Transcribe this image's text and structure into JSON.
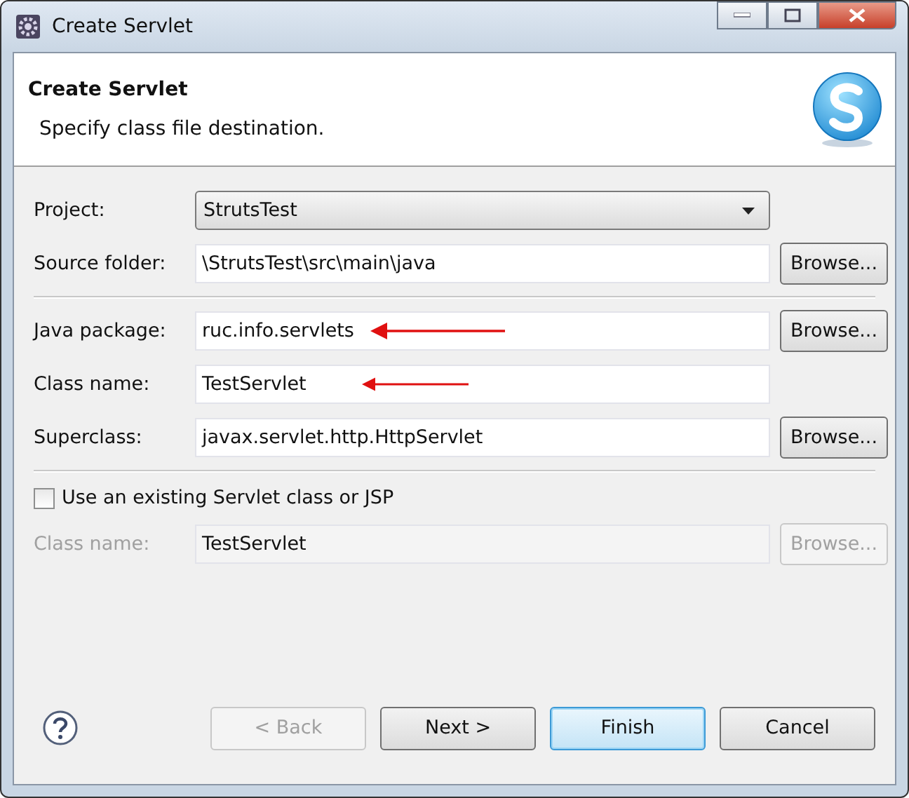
{
  "window": {
    "title": "Create Servlet"
  },
  "header": {
    "title": "Create Servlet",
    "description": "Specify class file destination."
  },
  "groups": [
    {
      "rows": [
        {
          "kind": "select",
          "label": "Project:",
          "value": "StrutsTest",
          "arrow": false
        },
        {
          "kind": "text",
          "label": "Source folder:",
          "value": "\\StrutsTest\\src\\main\\java",
          "browse": "Browse...",
          "arrow": false
        }
      ]
    },
    {
      "rows": [
        {
          "kind": "text",
          "label": "Java package:",
          "value": "ruc.info.servlets",
          "browse": "Browse...",
          "arrow": true
        },
        {
          "kind": "text",
          "label": "Class name:",
          "value": "TestServlet",
          "arrow": true
        },
        {
          "kind": "text",
          "label": "Superclass:",
          "value": "javax.servlet.http.HttpServlet",
          "browse": "Browse...",
          "arrow": false
        }
      ]
    }
  ],
  "existing": {
    "label": "Use an existing Servlet class or JSP",
    "checked": false,
    "row": {
      "label": "Class name:",
      "value": "TestServlet",
      "browse": "Browse..."
    }
  },
  "buttons": [
    {
      "label": "< Back",
      "disabled": true,
      "default": false
    },
    {
      "label": "Next >",
      "disabled": false,
      "default": false
    },
    {
      "label": "Finish",
      "disabled": false,
      "default": true
    },
    {
      "label": "Cancel",
      "disabled": false,
      "default": false
    }
  ]
}
